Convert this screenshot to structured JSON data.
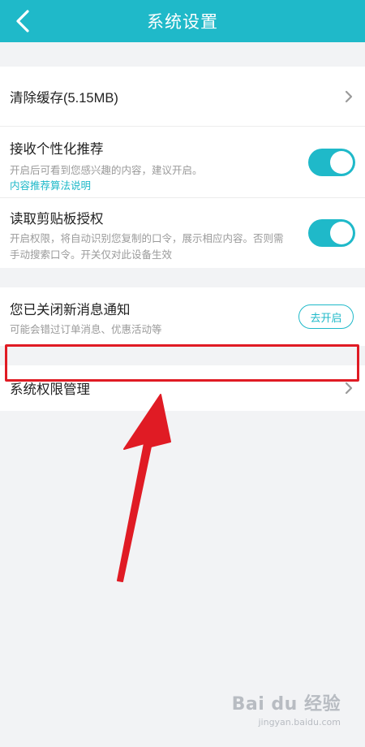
{
  "header": {
    "title": "系统设置"
  },
  "settings": {
    "clear_cache": {
      "label": "清除缓存(5.15MB)"
    },
    "personalized": {
      "label": "接收个性化推荐",
      "desc": "开启后可看到您感兴趣的内容，建议开启。",
      "link": "内容推荐算法说明",
      "enabled": true
    },
    "clipboard": {
      "label": "读取剪贴板授权",
      "desc": "开启权限，将自动识别您复制的口令，展示相应内容。否则需手动搜索口令。开关仅对此设备生效",
      "enabled": true
    },
    "notification": {
      "label": "您已关闭新消息通知",
      "desc": "可能会错过订单消息、优惠活动等",
      "button": "去开启"
    },
    "permissions": {
      "label": "系统权限管理"
    }
  },
  "watermark": {
    "logo": "Bai du 经验",
    "url": "jingyan.baidu.com"
  },
  "colors": {
    "accent": "#1fb9c9",
    "highlight": "#e01b24"
  }
}
